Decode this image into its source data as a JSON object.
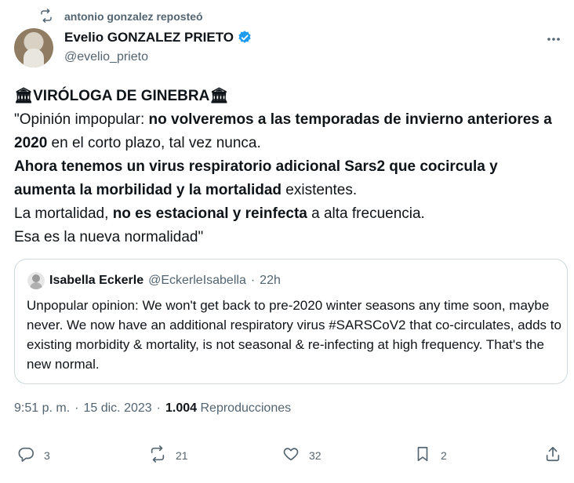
{
  "repost": {
    "text": "antonio gonzalez reposteó",
    "icon": "repost-icon"
  },
  "author": {
    "name": "Evelio GONZALEZ PRIETO",
    "handle": "@evelio_prieto",
    "verified_color": "#1d9bf0"
  },
  "tweet": {
    "line1": {
      "prefix_icon": "🏛",
      "title": "VIRÓLOGA DE GINEBRA",
      "suffix_icon": "🏛"
    },
    "para1": {
      "a": "\"Opinión impopular: ",
      "b": "no volveremos a las temporadas de invierno anteriores a 2020",
      "c": " en el corto plazo, tal vez nunca."
    },
    "para2": {
      "b": "Ahora tenemos un virus respiratorio adicional Sars2 que cocircula y aumenta la morbilidad y la mortalidad",
      "c": " existentes."
    },
    "para3": {
      "a": "La mortalidad, ",
      "b": "no es estacional y reinfecta",
      "c": " a alta frecuencia."
    },
    "para4": "Esa es la nueva normalidad\""
  },
  "quote": {
    "name": "Isabella Eckerle",
    "handle": "@EckerleIsabella",
    "sep": "·",
    "time": "22h",
    "text": "Unpopular opinion: We won't get back to pre-2020 winter seasons any time soon, maybe never. We now have an additional respiratory virus #SARSCoV2 that co-circulates, adds to existing morbidity & mortality, is not seasonal & re-infecting at high frequency. That's the new normal."
  },
  "meta": {
    "time": "9:51 p. m.",
    "sep1": "·",
    "date": "15 dic. 2023",
    "sep2": "·",
    "views": "1.004",
    "views_label": "Reproducciones"
  },
  "actions": {
    "replies": "3",
    "reposts": "21",
    "likes": "32",
    "bookmarks": "2"
  },
  "colors": {
    "muted": "#536471",
    "text": "#0f1419",
    "border": "#cfd9de",
    "accent": "#1d9bf0"
  }
}
